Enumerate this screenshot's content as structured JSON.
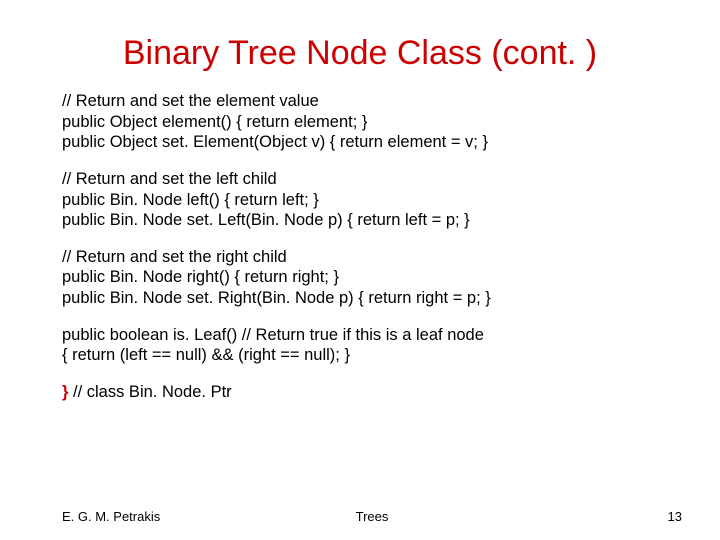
{
  "title": "Binary Tree Node Class (cont. )",
  "blocks": {
    "b1": {
      "l1": "// Return and set the element value",
      "l2": " public Object element() { return element; }",
      "l3": " public Object set. Element(Object v) { return element = v; }"
    },
    "b2": {
      "l1": "// Return and set the left child",
      "l2": "public Bin. Node left() { return left; }",
      "l3": "public Bin. Node set. Left(Bin. Node p) { return left = p; }"
    },
    "b3": {
      "l1": "// Return and set the right child",
      "l2": "public Bin. Node right() { return right; }",
      "l3": "public Bin. Node set. Right(Bin. Node p) { return right = p; }"
    },
    "b4": {
      "l1": "public boolean is. Leaf()    // Return true if this is a leaf node",
      "l2": "{ return (left == null) && (right == null); }"
    },
    "close": {
      "brace": "}",
      "comment": " // class Bin. Node. Ptr"
    }
  },
  "footer": {
    "left": "E. G. M. Petrakis",
    "center": "Trees",
    "right": "13"
  }
}
